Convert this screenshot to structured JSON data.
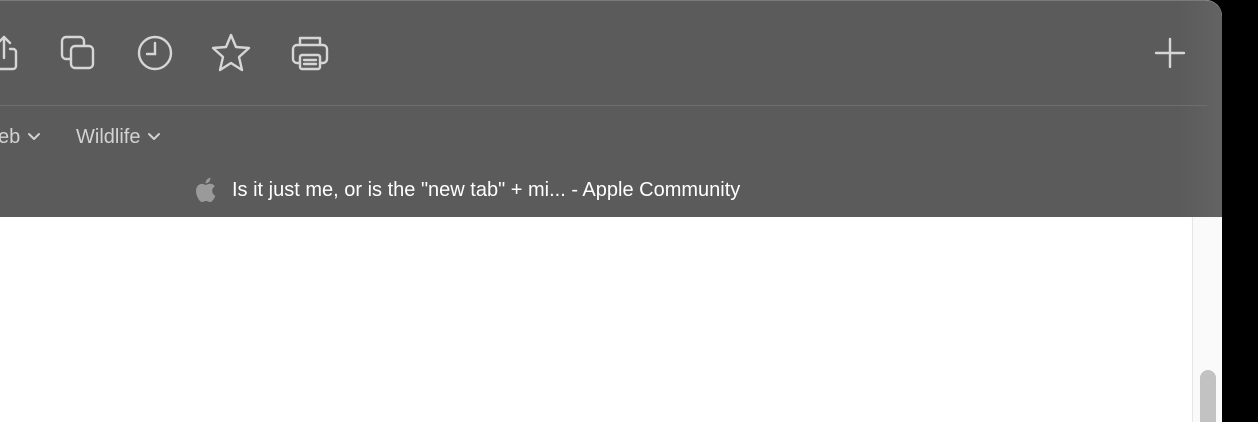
{
  "toolbar": {
    "icons": [
      "share-icon",
      "tab-overview-icon",
      "history-icon",
      "bookmarks-icon",
      "print-icon"
    ],
    "new_tab_icon": "plus-icon"
  },
  "favorites": {
    "items": [
      {
        "label": "eb",
        "icon": "chevron-down-icon"
      },
      {
        "label": "Wildlife",
        "icon": "chevron-down-icon"
      }
    ]
  },
  "tab": {
    "favicon": "apple-logo-icon",
    "title": "Is it just me, or is the \"new tab\" + mi... - Apple Community"
  },
  "colors": {
    "chrome_bg": "#5b5b5b",
    "icon": "#d6d6d6",
    "tab_text": "#ffffff",
    "favorites_text": "#d2d2d2",
    "content_bg": "#ffffff"
  }
}
